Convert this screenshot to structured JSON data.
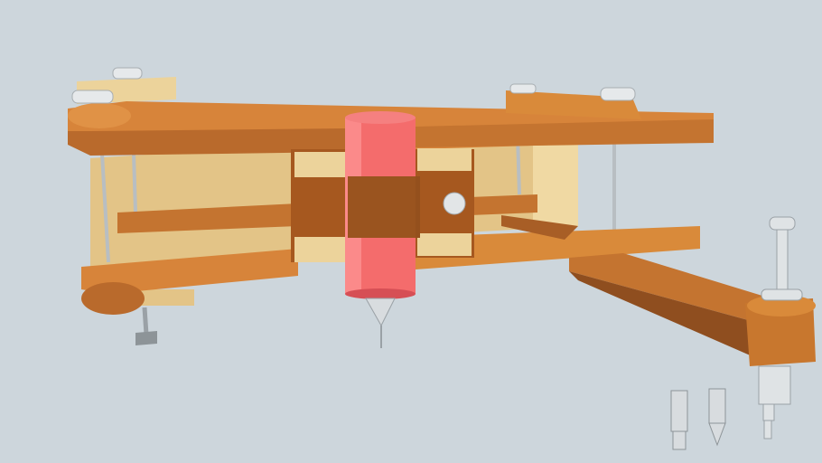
{
  "scene": {
    "subject": "pantograph-router-jig-model",
    "colors": {
      "background": "#cdd6dc",
      "wood_top": "#d98a3a",
      "wood_side": "#b8682a",
      "wood_dark": "#8a4a1e",
      "plywood": "#e8c98a",
      "plywood_side": "#d6b070",
      "router_body": "#f26b6b",
      "router_shade": "#d94f55",
      "metal": "#d8dcdf",
      "metal_dark": "#9aa1a6"
    }
  }
}
